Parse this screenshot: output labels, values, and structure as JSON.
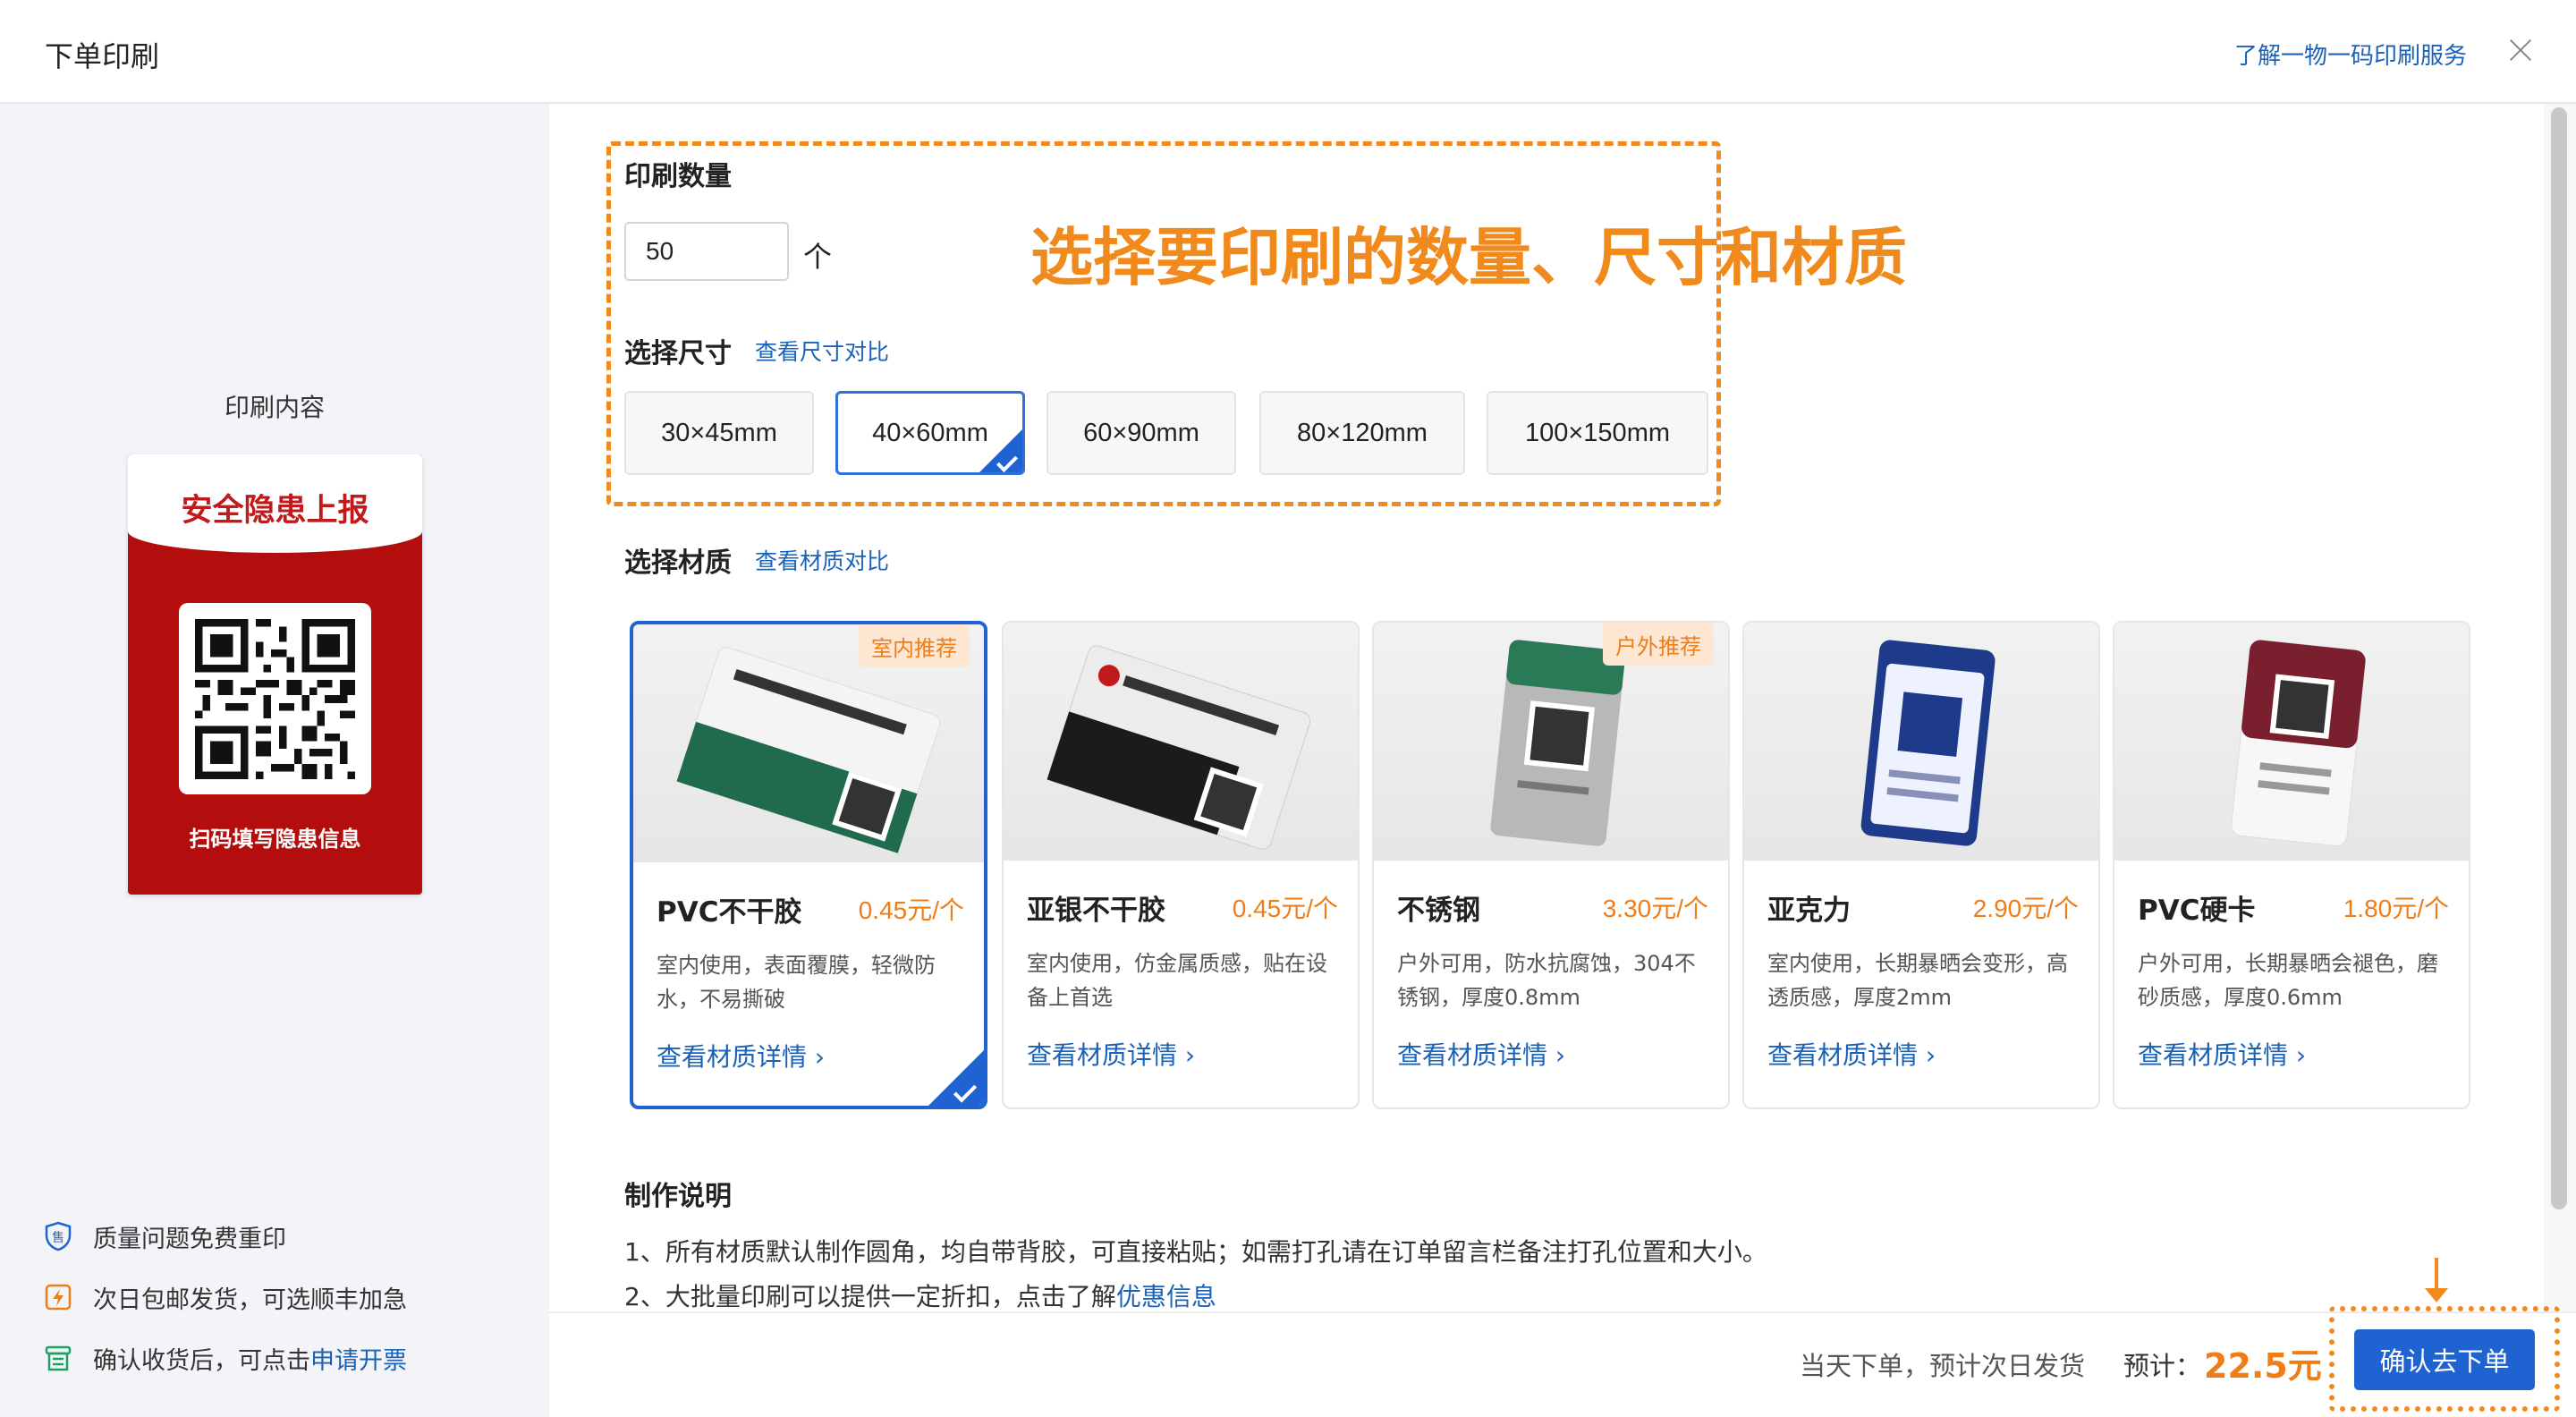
{
  "header": {
    "title": "下单印刷",
    "learn_link": "了解一物一码印刷服务"
  },
  "left": {
    "preview_label": "印刷内容",
    "poster": {
      "title": "安全隐患上报",
      "caption": "扫码填写隐患信息"
    },
    "guarantees": [
      {
        "icon": "shield-icon",
        "text": "质量问题免费重印"
      },
      {
        "icon": "lightning-icon",
        "text": "次日包邮发货，可选顺丰加急"
      },
      {
        "icon": "invoice-icon",
        "text": "确认收货后，可点击",
        "link": "申请开票"
      }
    ]
  },
  "quantity": {
    "title": "印刷数量",
    "value": "50",
    "unit": "个"
  },
  "annotation": "选择要印刷的数量、尺寸和材质",
  "size": {
    "title": "选择尺寸",
    "compare_link": "查看尺寸对比",
    "options": [
      "30×45mm",
      "40×60mm",
      "60×90mm",
      "80×120mm",
      "100×150mm"
    ],
    "selected": "40×60mm"
  },
  "material": {
    "title": "选择材质",
    "compare_link": "查看材质对比",
    "detail_link": "查看材质详情 ›",
    "cards": [
      {
        "name": "PVC不干胶",
        "price": "0.45元/个",
        "desc": "室内使用，表面覆膜，轻微防水，不易撕破",
        "badge": "室内推荐",
        "selected": true
      },
      {
        "name": "亚银不干胶",
        "price": "0.45元/个",
        "desc": "室内使用，仿金属质感，贴在设备上首选",
        "badge": "",
        "selected": false
      },
      {
        "name": "不锈钢",
        "price": "3.30元/个",
        "desc": "户外可用，防水抗腐蚀，304不锈钢，厚度0.8mm",
        "badge": "户外推荐",
        "selected": false
      },
      {
        "name": "亚克力",
        "price": "2.90元/个",
        "desc": "室内使用，长期暴晒会变形，高透质感，厚度2mm",
        "badge": "",
        "selected": false
      },
      {
        "name": "PVC硬卡",
        "price": "1.80元/个",
        "desc": "户外可用，长期暴晒会褪色，磨砂质感，厚度0.6mm",
        "badge": "",
        "selected": false
      }
    ]
  },
  "notes": {
    "title": "制作说明",
    "line1": "1、所有材质默认制作圆角，均自带背胶，可直接粘贴；如需打孔请在订单留言栏备注打孔位置和大小。",
    "line2_prefix": "2、大批量印刷可以提供一定折扣，点击了解",
    "line2_link": "优惠信息"
  },
  "footer": {
    "ship_text": "当天下单，预计次日发货",
    "total_label": "预计：",
    "total_value": "22.5元",
    "confirm_label": "确认去下单"
  },
  "colors": {
    "accent_blue": "#1f63d2",
    "link_blue": "#1a62b8",
    "orange": "#ee7d18",
    "annotation_orange": "#f08a1c",
    "poster_red": "#b30d0d"
  }
}
